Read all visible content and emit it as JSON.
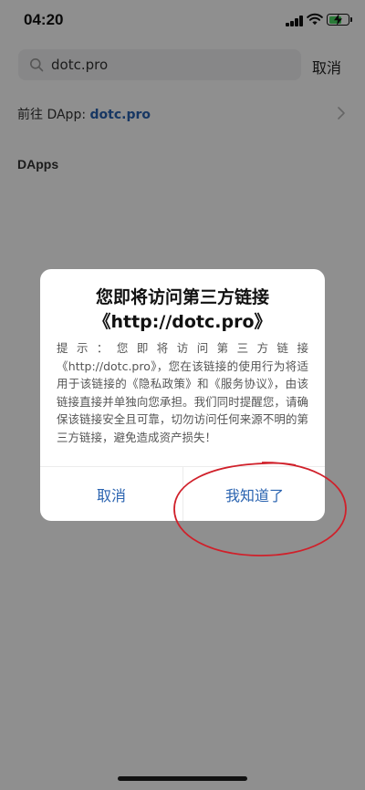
{
  "status_bar": {
    "time": "04:20"
  },
  "search": {
    "value": "dotc.pro",
    "cancel_label": "取消"
  },
  "dapp_row": {
    "prefix": "前往 DApp: ",
    "link": "dotc.pro"
  },
  "section": {
    "title": "DApps"
  },
  "modal": {
    "title": "您即将访问第三方链接《http://dotc.pro》",
    "body": "提示：您即将访问第三方链接《http://dotc.pro》，您在该链接的使用行为将适用于该链接的《隐私政策》和《服务协议》，由该链接直接并单独向您承担。我们同时提醒您，请确保该链接安全且可靠，切勿访问任何来源不明的第三方链接，避免造成资产损失！",
    "cancel_label": "取消",
    "confirm_label": "我知道了"
  },
  "colors": {
    "accent": "#2a63b0",
    "annotation": "#d0202a",
    "battery": "#4cd964"
  },
  "battery_level": 0.68
}
